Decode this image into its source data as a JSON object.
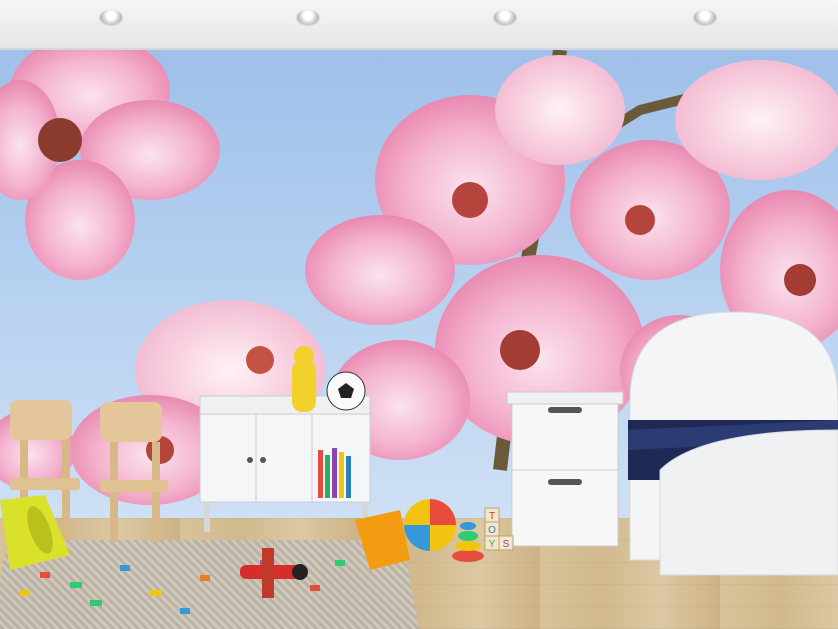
{
  "scene": {
    "kind": "kids room interior with cherry blossom wall mural",
    "wall_sky_color": "#a9c6ec",
    "blossom_color": "#f3a8c8",
    "toy_box_letters": [
      "T",
      "O",
      "Y",
      "S"
    ]
  }
}
